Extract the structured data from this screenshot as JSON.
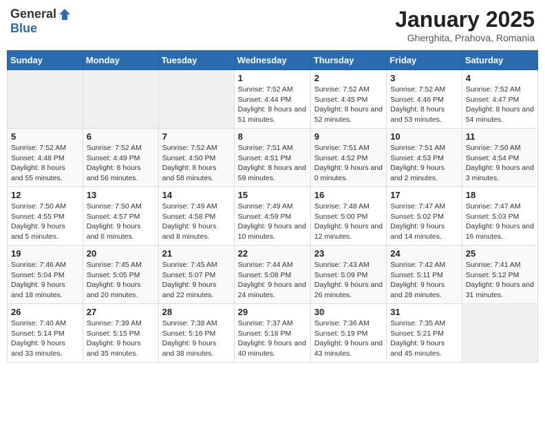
{
  "logo": {
    "general": "General",
    "blue": "Blue"
  },
  "title": {
    "month": "January 2025",
    "location": "Gherghita, Prahova, Romania"
  },
  "weekdays": [
    "Sunday",
    "Monday",
    "Tuesday",
    "Wednesday",
    "Thursday",
    "Friday",
    "Saturday"
  ],
  "weeks": [
    [
      {
        "day": "",
        "info": ""
      },
      {
        "day": "",
        "info": ""
      },
      {
        "day": "",
        "info": ""
      },
      {
        "day": "1",
        "info": "Sunrise: 7:52 AM\nSunset: 4:44 PM\nDaylight: 8 hours\nand 51 minutes."
      },
      {
        "day": "2",
        "info": "Sunrise: 7:52 AM\nSunset: 4:45 PM\nDaylight: 8 hours\nand 52 minutes."
      },
      {
        "day": "3",
        "info": "Sunrise: 7:52 AM\nSunset: 4:46 PM\nDaylight: 8 hours\nand 53 minutes."
      },
      {
        "day": "4",
        "info": "Sunrise: 7:52 AM\nSunset: 4:47 PM\nDaylight: 8 hours\nand 54 minutes."
      }
    ],
    [
      {
        "day": "5",
        "info": "Sunrise: 7:52 AM\nSunset: 4:48 PM\nDaylight: 8 hours\nand 55 minutes."
      },
      {
        "day": "6",
        "info": "Sunrise: 7:52 AM\nSunset: 4:49 PM\nDaylight: 8 hours\nand 56 minutes."
      },
      {
        "day": "7",
        "info": "Sunrise: 7:52 AM\nSunset: 4:50 PM\nDaylight: 8 hours\nand 58 minutes."
      },
      {
        "day": "8",
        "info": "Sunrise: 7:51 AM\nSunset: 4:51 PM\nDaylight: 8 hours\nand 59 minutes."
      },
      {
        "day": "9",
        "info": "Sunrise: 7:51 AM\nSunset: 4:52 PM\nDaylight: 9 hours\nand 0 minutes."
      },
      {
        "day": "10",
        "info": "Sunrise: 7:51 AM\nSunset: 4:53 PM\nDaylight: 9 hours\nand 2 minutes."
      },
      {
        "day": "11",
        "info": "Sunrise: 7:50 AM\nSunset: 4:54 PM\nDaylight: 9 hours\nand 3 minutes."
      }
    ],
    [
      {
        "day": "12",
        "info": "Sunrise: 7:50 AM\nSunset: 4:55 PM\nDaylight: 9 hours\nand 5 minutes."
      },
      {
        "day": "13",
        "info": "Sunrise: 7:50 AM\nSunset: 4:57 PM\nDaylight: 9 hours\nand 6 minutes."
      },
      {
        "day": "14",
        "info": "Sunrise: 7:49 AM\nSunset: 4:58 PM\nDaylight: 9 hours\nand 8 minutes."
      },
      {
        "day": "15",
        "info": "Sunrise: 7:49 AM\nSunset: 4:59 PM\nDaylight: 9 hours\nand 10 minutes."
      },
      {
        "day": "16",
        "info": "Sunrise: 7:48 AM\nSunset: 5:00 PM\nDaylight: 9 hours\nand 12 minutes."
      },
      {
        "day": "17",
        "info": "Sunrise: 7:47 AM\nSunset: 5:02 PM\nDaylight: 9 hours\nand 14 minutes."
      },
      {
        "day": "18",
        "info": "Sunrise: 7:47 AM\nSunset: 5:03 PM\nDaylight: 9 hours\nand 16 minutes."
      }
    ],
    [
      {
        "day": "19",
        "info": "Sunrise: 7:46 AM\nSunset: 5:04 PM\nDaylight: 9 hours\nand 18 minutes."
      },
      {
        "day": "20",
        "info": "Sunrise: 7:45 AM\nSunset: 5:05 PM\nDaylight: 9 hours\nand 20 minutes."
      },
      {
        "day": "21",
        "info": "Sunrise: 7:45 AM\nSunset: 5:07 PM\nDaylight: 9 hours\nand 22 minutes."
      },
      {
        "day": "22",
        "info": "Sunrise: 7:44 AM\nSunset: 5:08 PM\nDaylight: 9 hours\nand 24 minutes."
      },
      {
        "day": "23",
        "info": "Sunrise: 7:43 AM\nSunset: 5:09 PM\nDaylight: 9 hours\nand 26 minutes."
      },
      {
        "day": "24",
        "info": "Sunrise: 7:42 AM\nSunset: 5:11 PM\nDaylight: 9 hours\nand 28 minutes."
      },
      {
        "day": "25",
        "info": "Sunrise: 7:41 AM\nSunset: 5:12 PM\nDaylight: 9 hours\nand 31 minutes."
      }
    ],
    [
      {
        "day": "26",
        "info": "Sunrise: 7:40 AM\nSunset: 5:14 PM\nDaylight: 9 hours\nand 33 minutes."
      },
      {
        "day": "27",
        "info": "Sunrise: 7:39 AM\nSunset: 5:15 PM\nDaylight: 9 hours\nand 35 minutes."
      },
      {
        "day": "28",
        "info": "Sunrise: 7:38 AM\nSunset: 5:16 PM\nDaylight: 9 hours\nand 38 minutes."
      },
      {
        "day": "29",
        "info": "Sunrise: 7:37 AM\nSunset: 5:18 PM\nDaylight: 9 hours\nand 40 minutes."
      },
      {
        "day": "30",
        "info": "Sunrise: 7:36 AM\nSunset: 5:19 PM\nDaylight: 9 hours\nand 43 minutes."
      },
      {
        "day": "31",
        "info": "Sunrise: 7:35 AM\nSunset: 5:21 PM\nDaylight: 9 hours\nand 45 minutes."
      },
      {
        "day": "",
        "info": ""
      }
    ]
  ]
}
